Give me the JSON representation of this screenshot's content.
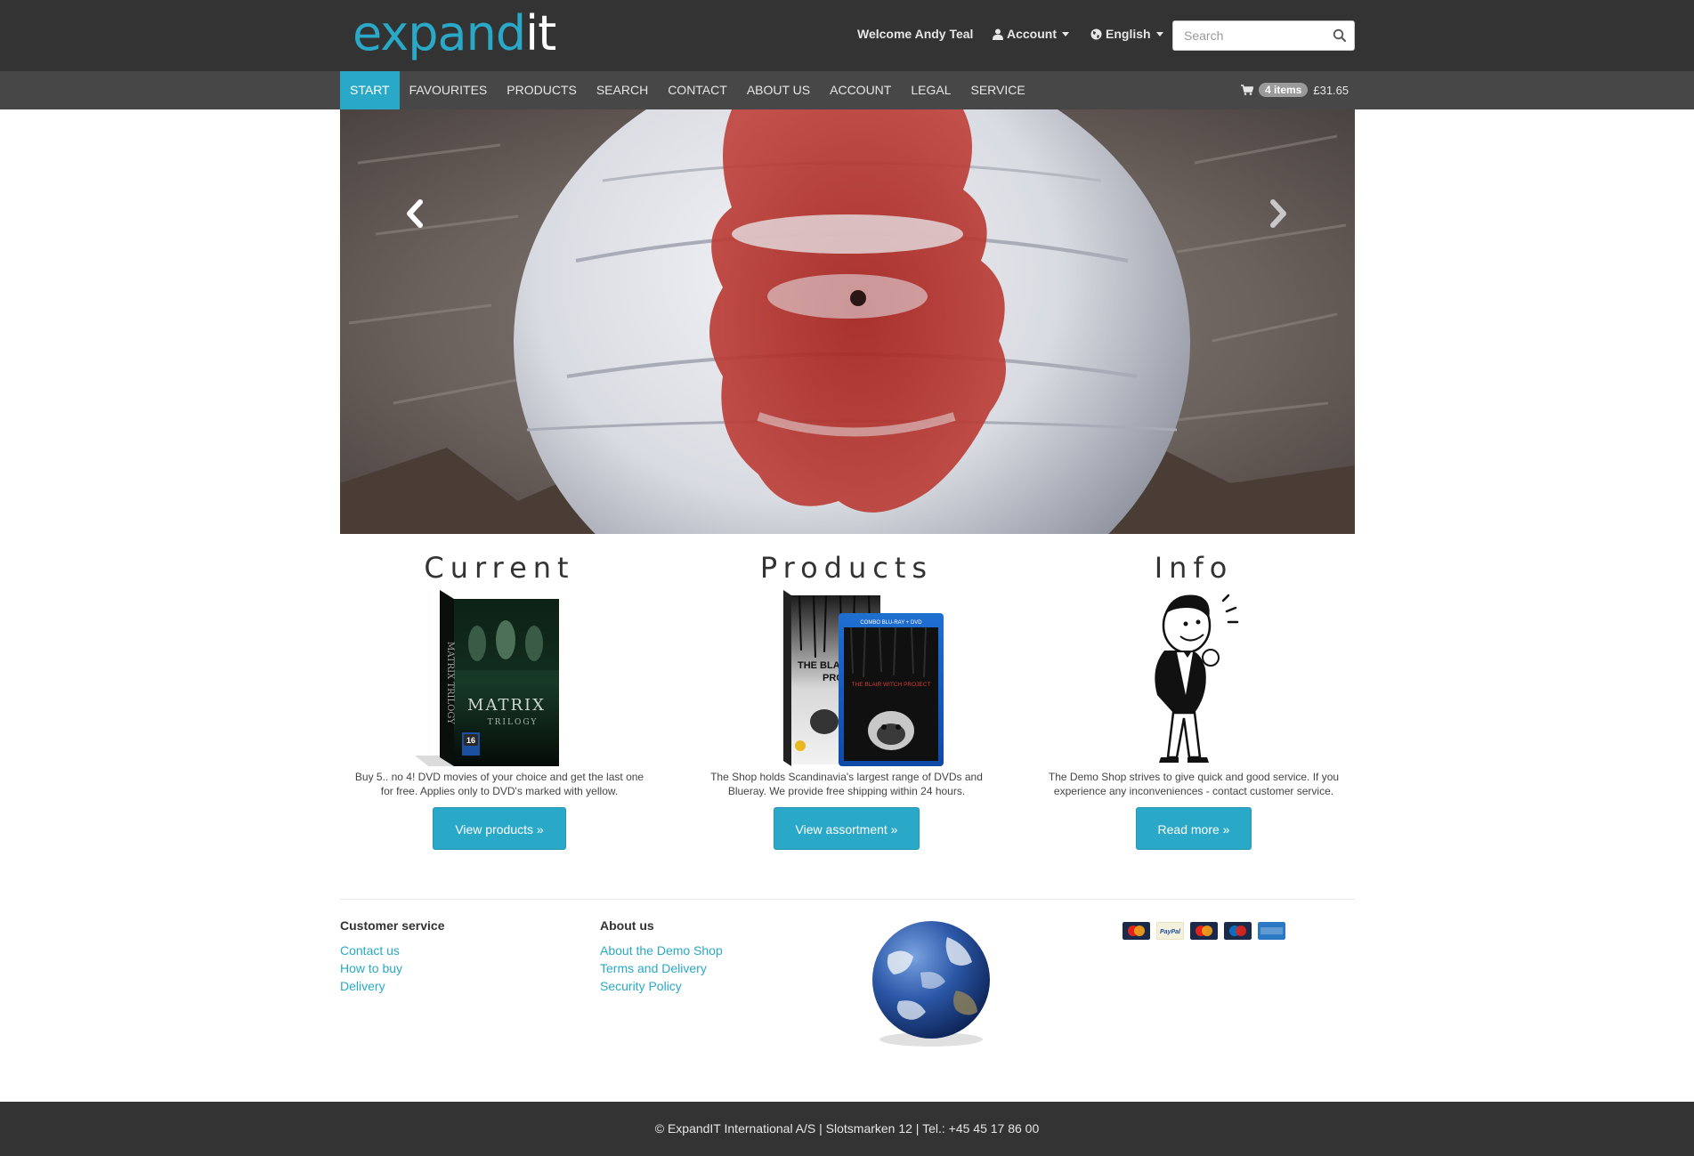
{
  "header": {
    "logo_main": "expand",
    "logo_accent": "it",
    "welcome": "Welcome Andy Teal",
    "account_label": "Account",
    "language_label": "English",
    "search_placeholder": "Search"
  },
  "nav": {
    "items": [
      {
        "label": "START",
        "active": true
      },
      {
        "label": "FAVOURITES"
      },
      {
        "label": "PRODUCTS"
      },
      {
        "label": "SEARCH"
      },
      {
        "label": "CONTACT"
      },
      {
        "label": "ABOUT US"
      },
      {
        "label": "ACCOUNT"
      },
      {
        "label": "LEGAL"
      },
      {
        "label": "SERVICE"
      }
    ],
    "cart_count": "4 items",
    "cart_total": "£31.65"
  },
  "features": [
    {
      "title": "Current",
      "text": "Buy 5.. no 4!  DVD movies of your choice and get the last one for free. Applies only to DVD's marked with yellow.",
      "button": "View products »",
      "dvd_title": "MATRIX",
      "dvd_subtitle": "TRILOGY",
      "rating": "16"
    },
    {
      "title": "Products",
      "text": "The Shop holds Scandinavia's largest range of DVDs and Blueray. We provide free shipping within 24 hours.",
      "button": "View assortment »",
      "dvd_title": "THE BLAIR WITCH PROJECT",
      "dvd_back_title": "THE BLAI PROJ"
    },
    {
      "title": "Info",
      "text": "The Demo Shop strives to give quick and good service. If you experience any inconveniences - contact customer service.",
      "button": "Read more »"
    }
  ],
  "footer": {
    "customer_service": {
      "heading": "Customer service",
      "links": [
        "Contact us",
        "How to buy",
        "Delivery"
      ]
    },
    "about_us": {
      "heading": "About us",
      "links": [
        "About the Demo Shop",
        "Terms and Delivery",
        "Security Policy"
      ]
    },
    "payment_methods": [
      "MasterCard",
      "PayPal",
      "MasterCard",
      "Maestro",
      "American Express"
    ],
    "copyright": "© ExpandIT International A/S | Slotsmarken 12 | Tel.: +45 45 17 86 00"
  },
  "colors": {
    "accent": "#2aa8c7",
    "header_bg": "#333333",
    "nav_bg": "#474747"
  }
}
